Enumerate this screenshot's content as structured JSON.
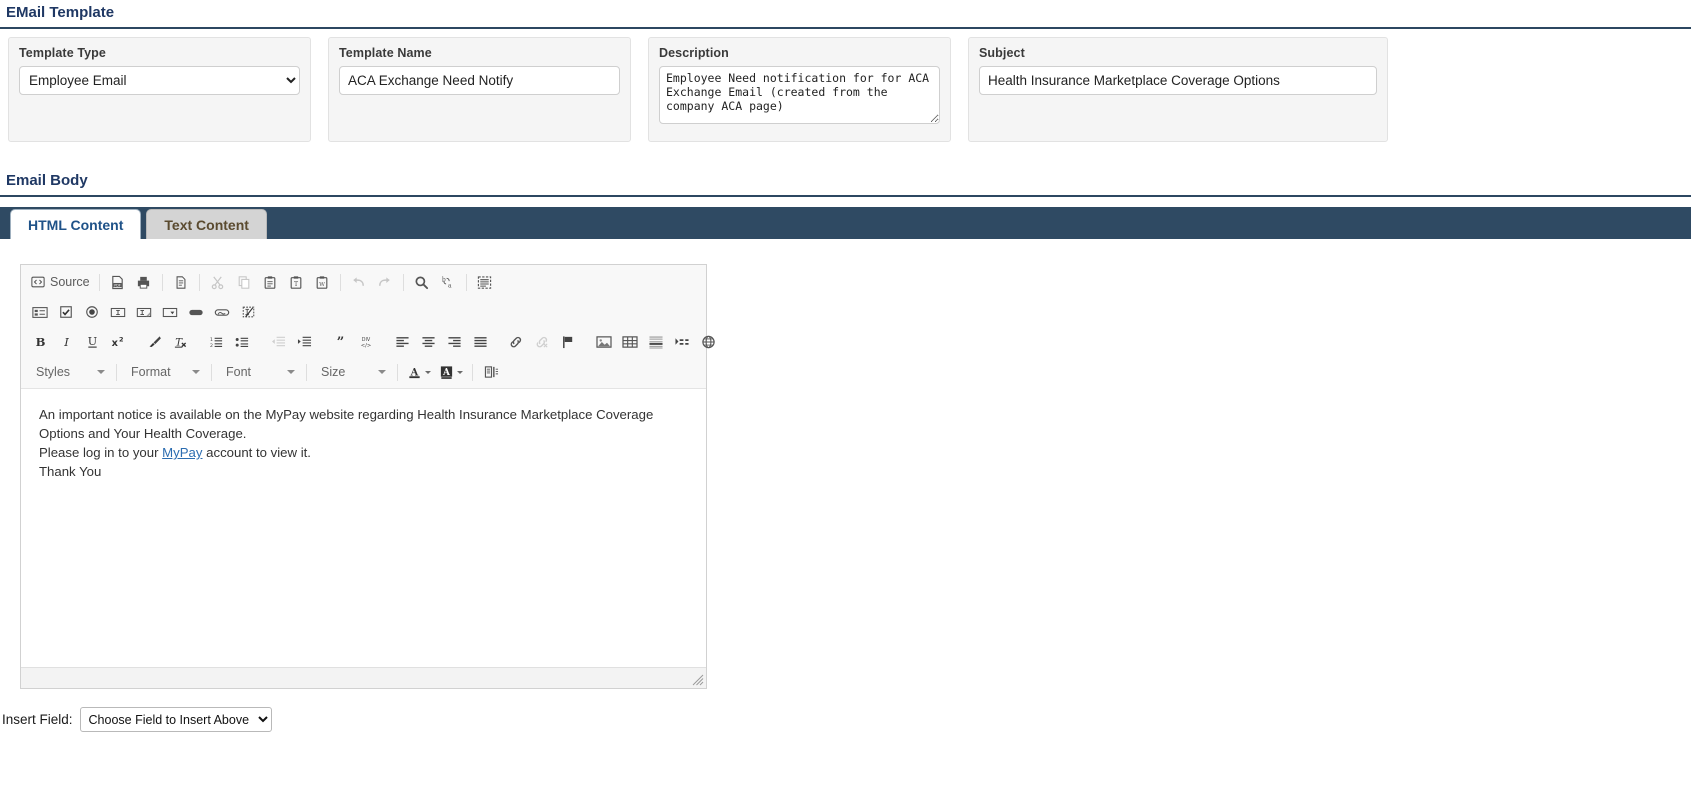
{
  "page": {
    "title": "EMail Template",
    "body_section_title": "Email Body"
  },
  "fields": {
    "template_type": {
      "label": "Template Type",
      "value": "Employee Email",
      "options": [
        "Employee Email"
      ]
    },
    "template_name": {
      "label": "Template Name",
      "value": "ACA Exchange Need Notify",
      "placeholder": ""
    },
    "description": {
      "label": "Description",
      "value": "Employee Need notification for for ACA Exchange Email (created from the company ACA page)",
      "placeholder": ""
    },
    "subject": {
      "label": "Subject",
      "value": "Health Insurance Marketplace Coverage Options",
      "placeholder": ""
    }
  },
  "tabs": [
    {
      "label": "HTML Content",
      "active": true
    },
    {
      "label": "Text Content",
      "active": false
    }
  ],
  "editor": {
    "source_label": "Source",
    "row1_icons": [
      "source-icon",
      "pdf-icon",
      "print-icon",
      "new-page-icon",
      "cut-icon",
      "copy-icon",
      "paste-icon",
      "paste-text-icon",
      "paste-word-icon",
      "undo-icon",
      "redo-icon",
      "find-icon",
      "replace-icon",
      "select-all-icon"
    ],
    "row2_icons": [
      "form-icon",
      "checkbox-icon",
      "radio-button-icon",
      "text-field-icon",
      "textarea-icon",
      "select-field-icon",
      "button-icon",
      "image-button-icon",
      "hidden-field-icon"
    ],
    "row3_icons": [
      "bold-icon",
      "italic-icon",
      "underline-icon",
      "superscript-icon",
      "remove-format-brush-icon",
      "remove-text-format-icon",
      "numbered-list-icon",
      "bulleted-list-icon",
      "decrease-indent-icon",
      "increase-indent-icon",
      "block-quote-icon",
      "div-container-icon",
      "align-left-icon",
      "align-center-icon",
      "align-right-icon",
      "justify-icon",
      "link-icon",
      "unlink-icon",
      "anchor-flag-icon",
      "image-icon",
      "table-icon",
      "horizontal-rule-icon",
      "page-break-icon",
      "globe-icon"
    ],
    "combos": [
      {
        "name": "Styles",
        "value": "Styles"
      },
      {
        "name": "Format",
        "value": "Format"
      },
      {
        "name": "Font",
        "value": "Font"
      },
      {
        "name": "Size",
        "value": "Size"
      }
    ],
    "color_buttons": [
      "text-color-icon",
      "background-color-icon",
      "show-blocks-icon"
    ],
    "content": {
      "line1": "An important notice is available on the MyPay website regarding Health Insurance Marketplace Coverage Options and Your Health Coverage.",
      "line2_before": "Please log in to your ",
      "line2_link": "MyPay",
      "line2_after": " account to view it.",
      "closing": "Thank You"
    }
  },
  "insert_field": {
    "label": "Insert Field:",
    "value": "Choose Field to Insert Above",
    "options": [
      "Choose Field to Insert Above"
    ]
  },
  "colors": {
    "header_text": "#1f3864",
    "rule": "#2c4761",
    "tabbar": "#2f4a63",
    "tab_active_text": "#1f5288",
    "tab_inactive_bg": "#d4d4d4",
    "link": "#2b6cb0",
    "panel_bg": "#f5f5f5"
  }
}
